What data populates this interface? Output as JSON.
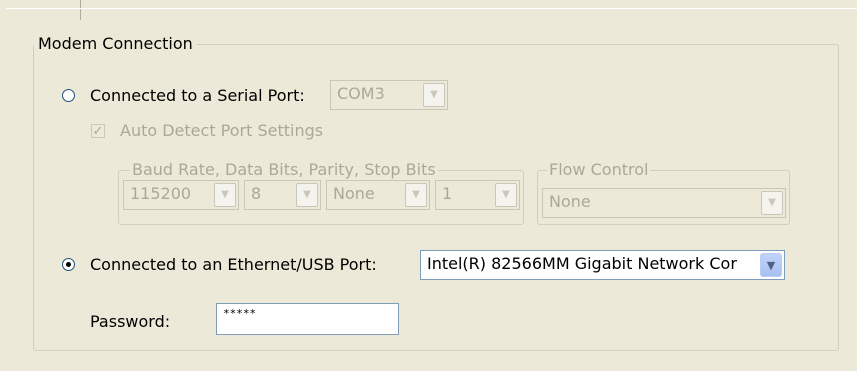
{
  "modem_connection": {
    "title": "Modem Connection",
    "serial": {
      "label": "Connected to a Serial Port:",
      "port_value": "COM3",
      "auto_detect_label": "Auto Detect Port Settings",
      "auto_detect_checked": true,
      "settings_group_title": "Baud Rate, Data Bits, Parity, Stop Bits",
      "baud_rate": "115200",
      "data_bits": "8",
      "parity": "None",
      "stop_bits": "1",
      "flow_group_title": "Flow Control",
      "flow_control": "None"
    },
    "ethernet": {
      "label": "Connected to an Ethernet/USB Port:",
      "adapter_value": "Intel(R) 82566MM Gigabit Network Cor",
      "selected": true
    },
    "password": {
      "label": "Password:",
      "value": "*****"
    }
  },
  "colors": {
    "background": "#ECE9D8",
    "disabled_text": "#ACA899",
    "field_border": "#7F9DB9",
    "dropdown_arrow": "#4D6185"
  }
}
